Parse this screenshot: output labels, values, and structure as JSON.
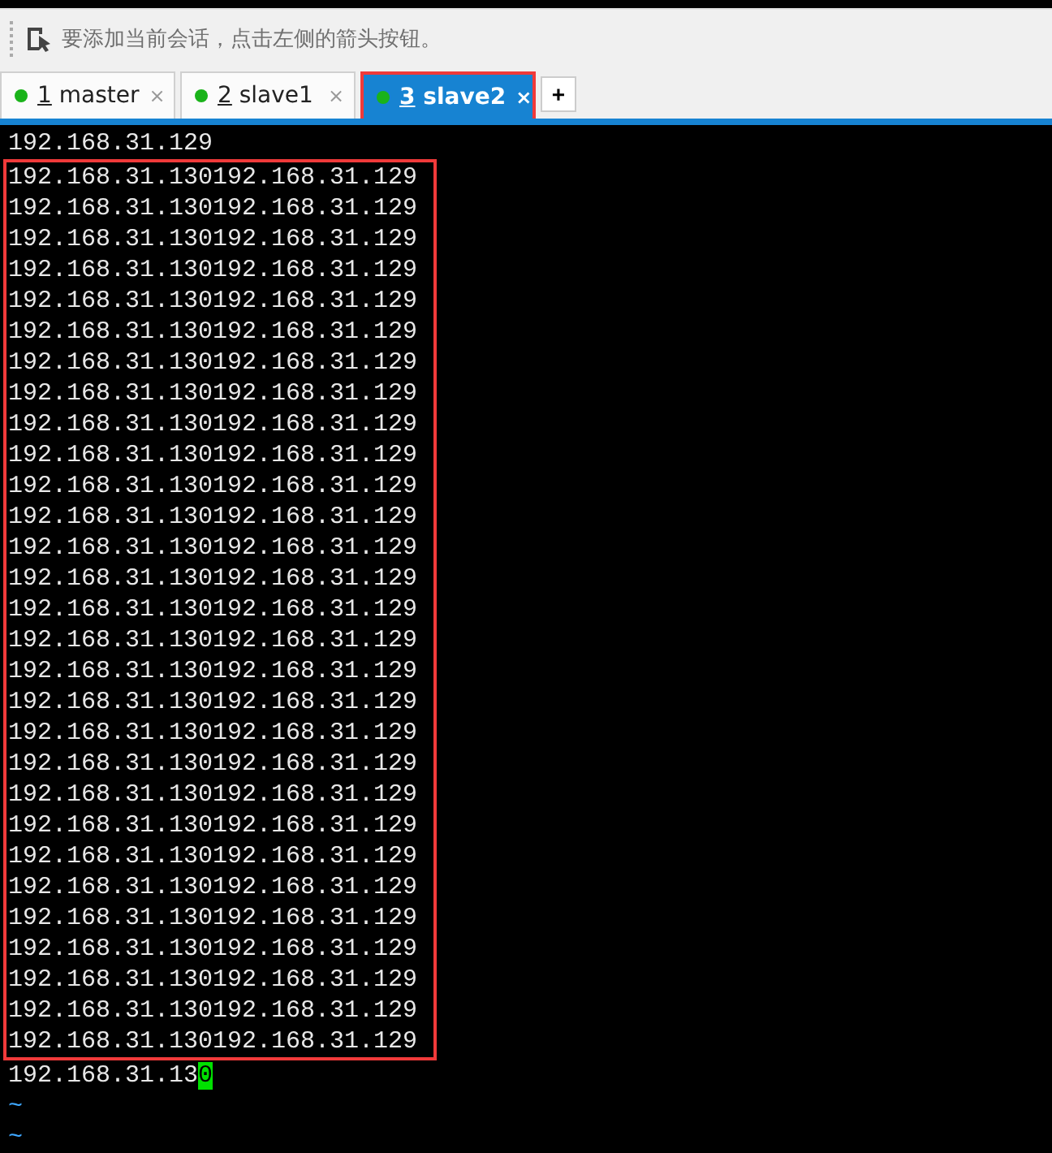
{
  "hint_bar": {
    "text": "要添加当前会话，点击左侧的箭头按钮。"
  },
  "tabs": [
    {
      "number": "1",
      "label": "master",
      "selected": false,
      "highlighted": false,
      "close": "×"
    },
    {
      "number": "2",
      "label": "slave1",
      "selected": false,
      "highlighted": false,
      "close": "×"
    },
    {
      "number": "3",
      "label": "slave2",
      "selected": true,
      "highlighted": true,
      "close": "×"
    }
  ],
  "new_tab": "+",
  "terminal": {
    "first_line": "192.168.31.129",
    "highlighted": true,
    "lines": [
      "192.168.31.130192.168.31.129",
      "192.168.31.130192.168.31.129",
      "192.168.31.130192.168.31.129",
      "192.168.31.130192.168.31.129",
      "192.168.31.130192.168.31.129",
      "192.168.31.130192.168.31.129",
      "192.168.31.130192.168.31.129",
      "192.168.31.130192.168.31.129",
      "192.168.31.130192.168.31.129",
      "192.168.31.130192.168.31.129",
      "192.168.31.130192.168.31.129",
      "192.168.31.130192.168.31.129",
      "192.168.31.130192.168.31.129",
      "192.168.31.130192.168.31.129",
      "192.168.31.130192.168.31.129",
      "192.168.31.130192.168.31.129",
      "192.168.31.130192.168.31.129",
      "192.168.31.130192.168.31.129",
      "192.168.31.130192.168.31.129",
      "192.168.31.130192.168.31.129",
      "192.168.31.130192.168.31.129",
      "192.168.31.130192.168.31.129",
      "192.168.31.130192.168.31.129",
      "192.168.31.130192.168.31.129",
      "192.168.31.130192.168.31.129",
      "192.168.31.130192.168.31.129",
      "192.168.31.130192.168.31.129",
      "192.168.31.130192.168.31.129",
      "192.168.31.130192.168.31.129"
    ],
    "last_line": {
      "text": "192.168.31.13",
      "cursor": "0"
    },
    "tildes": [
      "~",
      "~"
    ]
  }
}
